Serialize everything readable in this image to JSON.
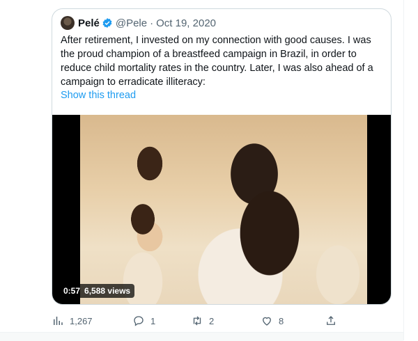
{
  "quoted_tweet": {
    "author_name": "Pelé",
    "author_handle": "@Pele",
    "separator": "·",
    "date": "Oct 19, 2020",
    "text_lines": [
      "After retirement, I invested on my connection with good causes. I was",
      "the proud champion of a breastfeed campaign in Brazil, in order to",
      "reduce child mortality rates in the country. Later, I was also ahead of a",
      "campaign to erradicate illiteracy:"
    ],
    "show_thread": "Show this thread",
    "video": {
      "duration": "0:57",
      "views": "6,588 views"
    }
  },
  "actions": {
    "views": "1,267",
    "replies": "1",
    "retweets": "2",
    "likes": "8"
  },
  "icons": [
    "verified-icon",
    "analytics-icon",
    "reply-icon",
    "retweet-icon",
    "like-icon",
    "share-icon"
  ],
  "colors": {
    "accent": "#1d9bf0",
    "secondary_text": "#536471",
    "border": "#cfd9de"
  }
}
